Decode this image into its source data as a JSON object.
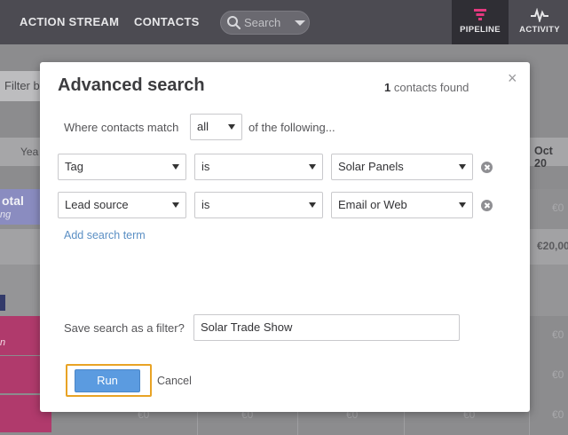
{
  "nav": {
    "links": [
      "ACTION STREAM",
      "CONTACTS"
    ],
    "search_placeholder": "Search",
    "tabs": [
      {
        "label": "PIPELINE",
        "icon": "funnel-icon",
        "active": true,
        "color": "#e4397f"
      },
      {
        "label": "ACTIVITY",
        "icon": "pulse-icon",
        "active": false
      }
    ]
  },
  "background": {
    "filter_text": "Filter b",
    "col_header_left": "Yea",
    "col_header_right": "Oct 20",
    "total_label": "otal",
    "total_sub": "ng",
    "pink_sub": "n",
    "values": [
      "€0",
      "€20,00",
      "€0",
      "€0",
      "€0",
      "€0",
      "€0",
      "€0",
      "€0"
    ]
  },
  "modal": {
    "title": "Advanced search",
    "found_count": "1",
    "found_text": "contacts found",
    "close_label": "×",
    "match_prefix": "Where contacts match",
    "match_value": "all",
    "match_suffix": "of the following...",
    "terms": [
      {
        "field": "Tag",
        "operator": "is",
        "value": "Solar Panels"
      },
      {
        "field": "Lead source",
        "operator": "is",
        "value": "Email or Web"
      }
    ],
    "add_term_label": "Add search term",
    "save_label": "Save search as a filter?",
    "save_value": "Solar Trade Show",
    "run_label": "Run",
    "cancel_label": "Cancel",
    "colors": {
      "primary": "#5b9be0",
      "focus": "#e8a325",
      "link": "#5b8fc4"
    }
  }
}
